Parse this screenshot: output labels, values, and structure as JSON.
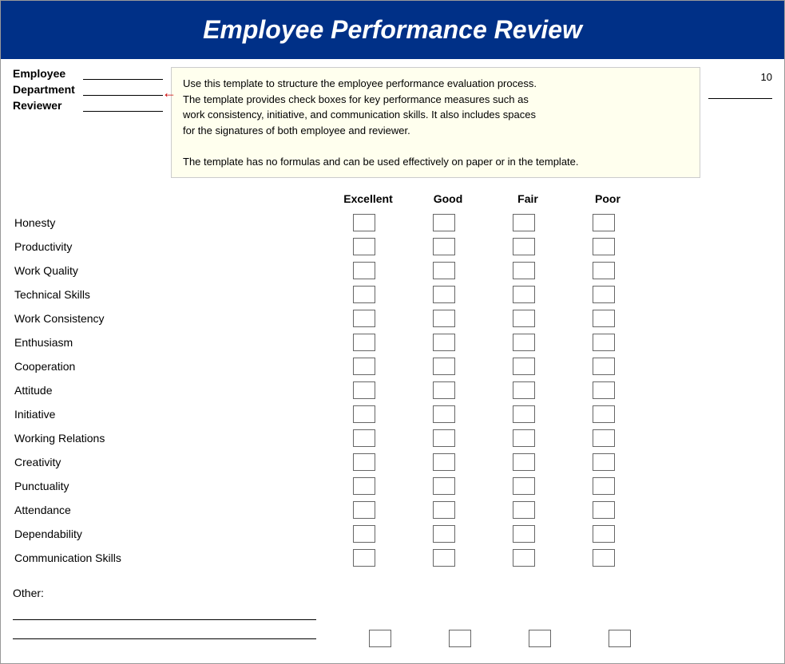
{
  "header": {
    "title": "Employee Performance Review"
  },
  "info": {
    "employee_label": "Employee",
    "department_label": "Department",
    "reviewer_label": "Reviewer",
    "right_label": "10"
  },
  "tooltip": {
    "text1": "Use this template to structure the employee performance evaluation process.",
    "text2": "The template provides check boxes for key performance measures such as",
    "text3": "work consistency, initiative, and communication skills. It also includes spaces",
    "text4": "for the signatures of both employee and reviewer.",
    "text5": "",
    "text6": "The template has no formulas and can be used effectively on paper or in the template."
  },
  "ratings": {
    "columns": [
      "Excellent",
      "Good",
      "Fair",
      "Poor"
    ]
  },
  "criteria": [
    "Honesty",
    "Productivity",
    "Work Quality",
    "Technical Skills",
    "Work Consistency",
    "Enthusiasm",
    "Cooperation",
    "Attitude",
    "Initiative",
    "Working Relations",
    "Creativity",
    "Punctuality",
    "Attendance",
    "Dependability",
    "Communication Skills"
  ],
  "other": {
    "label": "Other:"
  }
}
